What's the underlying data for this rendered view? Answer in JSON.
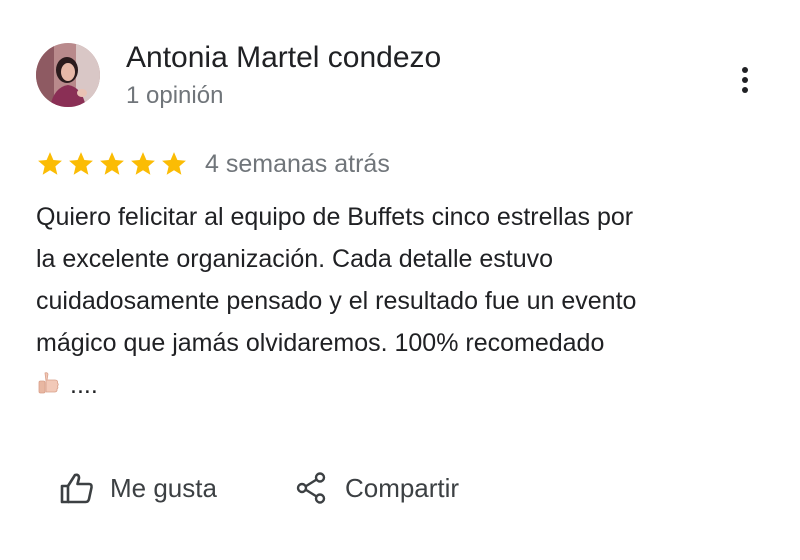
{
  "reviewer": {
    "name": "Antonia Martel condezo",
    "review_count": "1 opinión"
  },
  "review": {
    "rating": 5,
    "max_rating": 5,
    "date": "4 semanas atrás",
    "text_lines": [
      "Quiero felicitar al equipo de Buffets cinco estrellas por",
      "la excelente organización. Cada detalle estuvo",
      "cuidadosamente pensado y el resultado fue un evento",
      "mágico que jamás olvidaremos. 100% recomedado"
    ],
    "text_tail": "....",
    "emoji": "thumbs-up"
  },
  "actions": {
    "like_label": "Me gusta",
    "share_label": "Compartir"
  },
  "icons": {
    "more": "more-vert-icon",
    "like": "thumb-up-outline-icon",
    "share": "share-icon",
    "star": "star-icon"
  },
  "colors": {
    "star": "#fbbc04",
    "primary_text": "#202124",
    "secondary_text": "#70757a",
    "action_text": "#3c4043"
  }
}
